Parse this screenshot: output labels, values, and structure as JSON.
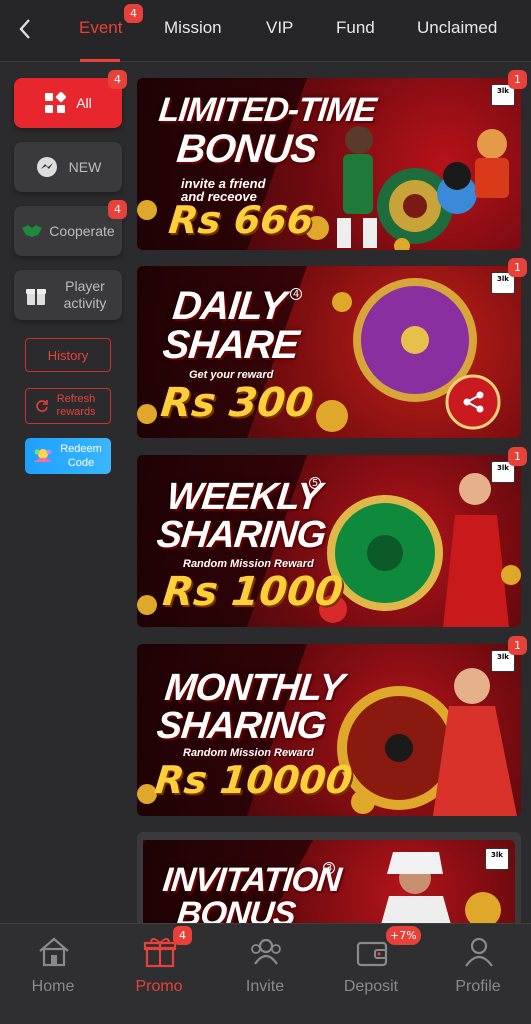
{
  "tabs": [
    {
      "label": "Event",
      "badge": "4"
    },
    {
      "label": "Mission"
    },
    {
      "label": "VIP"
    },
    {
      "label": "Fund"
    },
    {
      "label": "Unclaimed"
    }
  ],
  "sidebar": {
    "items": [
      {
        "label": "All",
        "badge": "4"
      },
      {
        "label": "NEW"
      },
      {
        "label": "Cooperate",
        "badge": "4"
      },
      {
        "label": "Player activity"
      }
    ],
    "history": "History",
    "refresh": "Refresh rewards",
    "redeem": "Redeem Code"
  },
  "banners": [
    {
      "title_line1": "LIMITED-TIME",
      "title_line2": "BONUS",
      "subtitle": "invite a friend and receove",
      "amount": "Rs 666",
      "badge": "1",
      "logo": "3lk"
    },
    {
      "title_line1": "DAILY",
      "title_line2": "SHARE",
      "number": "4",
      "subtitle": "Get your reward",
      "amount": "Rs 300",
      "badge": "1",
      "logo": "3lk"
    },
    {
      "title_line1": "WEEKLY",
      "title_line2": "SHARING",
      "number": "5",
      "subtitle": "Random Mission Reward",
      "amount": "Rs 1000",
      "badge": "1",
      "logo": "3lk"
    },
    {
      "title_line1": "MONTHLY",
      "title_line2": "SHARING",
      "subtitle": "Random Mission Reward",
      "amount": "Rs 10000",
      "badge": "1",
      "logo": "3lk"
    },
    {
      "title_line1": "INVITATION",
      "title_line2": "BONUS",
      "number": "3",
      "logo": "3lk"
    }
  ],
  "bottom_nav": [
    {
      "label": "Home",
      "icon": "home-icon"
    },
    {
      "label": "Promo",
      "icon": "gift-icon",
      "badge": "4"
    },
    {
      "label": "Invite",
      "icon": "users-icon"
    },
    {
      "label": "Deposit",
      "icon": "wallet-icon",
      "badge": "+7%"
    },
    {
      "label": "Profile",
      "icon": "profile-icon"
    }
  ],
  "colors": {
    "accent": "#e8413a",
    "background": "#2b2b2d",
    "gold": "#ffcf3a"
  }
}
